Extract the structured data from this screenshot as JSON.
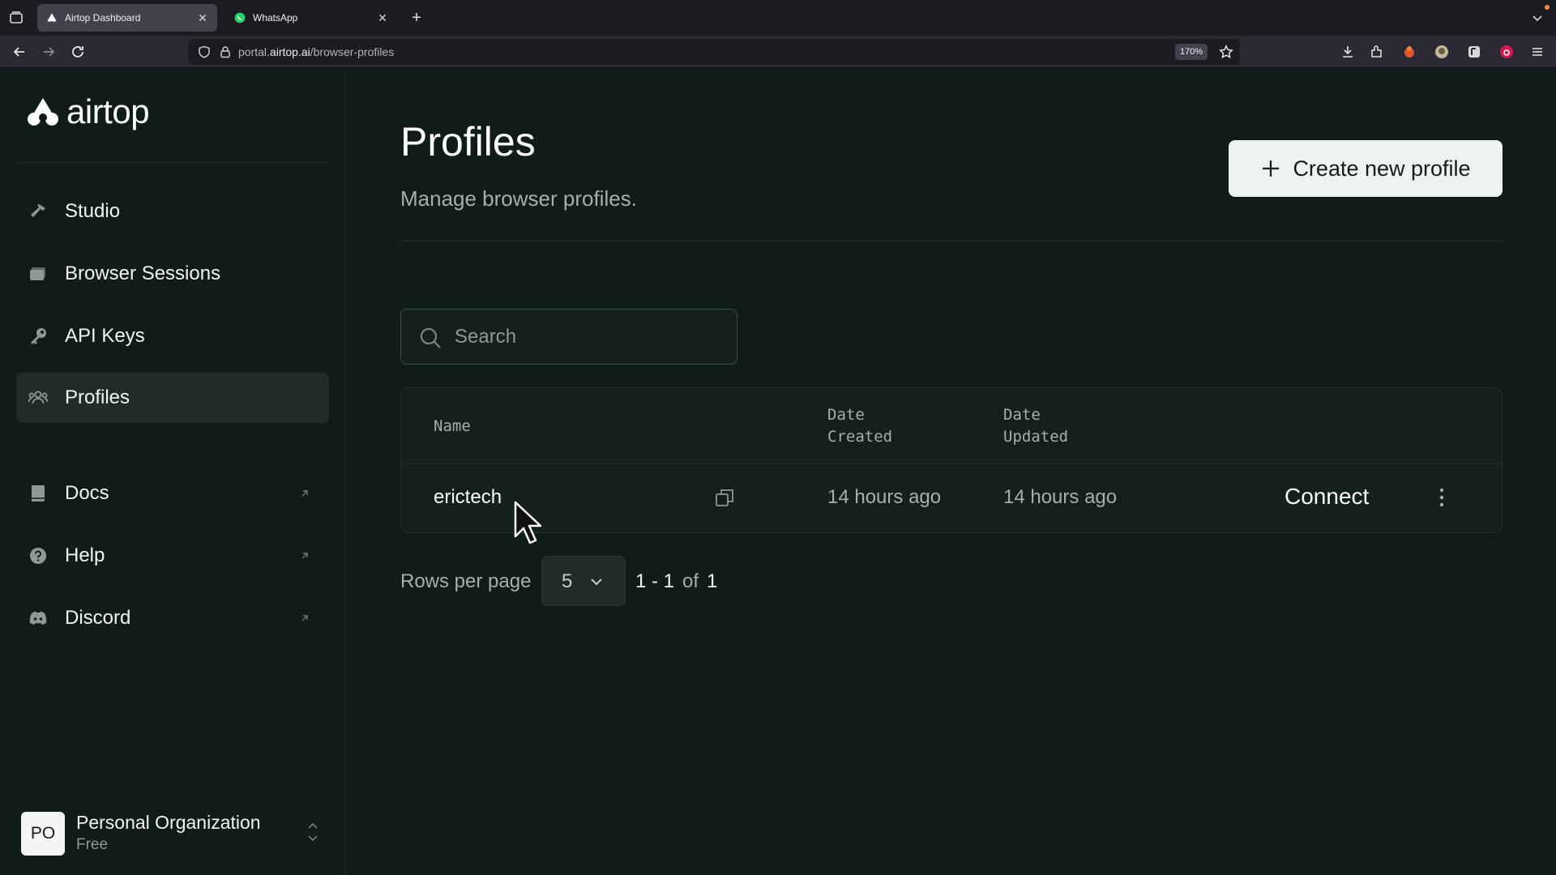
{
  "browser": {
    "tabs": [
      {
        "title": "Airtop Dashboard",
        "active": true
      },
      {
        "title": "WhatsApp",
        "active": false
      }
    ],
    "url_prefix": "portal.",
    "url_domain": "airtop.ai",
    "url_path": "/browser-profiles",
    "zoom": "170%"
  },
  "sidebar": {
    "brand": "airtop",
    "items": [
      {
        "label": "Studio",
        "icon": "hammer-icon"
      },
      {
        "label": "Browser Sessions",
        "icon": "browser-sessions-icon"
      },
      {
        "label": "API Keys",
        "icon": "key-icon"
      },
      {
        "label": "Profiles",
        "icon": "users-icon",
        "active": true
      },
      {
        "label": "Docs",
        "icon": "book-icon",
        "external": true
      },
      {
        "label": "Help",
        "icon": "help-circle-icon",
        "external": true
      },
      {
        "label": "Discord",
        "icon": "discord-icon",
        "external": true
      }
    ],
    "org": {
      "initials": "PO",
      "name": "Personal Organization",
      "plan": "Free"
    }
  },
  "main": {
    "title": "Profiles",
    "subtitle": "Manage browser profiles.",
    "create_button": "Create new profile",
    "search": {
      "placeholder": "Search",
      "value": ""
    },
    "table": {
      "headers": {
        "name": "Name",
        "created": "Date Created",
        "updated": "Date Updated"
      },
      "rows": [
        {
          "name": "erictech",
          "created": "14 hours ago",
          "updated": "14 hours ago",
          "action": "Connect"
        }
      ]
    },
    "pagination": {
      "rows_label": "Rows per page",
      "rows_value": "5",
      "range": "1 - 1",
      "of": "of",
      "total": "1"
    }
  },
  "colors": {
    "background": "#101c1a",
    "sidebar_active": "#1f2c2a",
    "primary_button": "#eef3f1",
    "muted_text": "#a3b0ad"
  }
}
